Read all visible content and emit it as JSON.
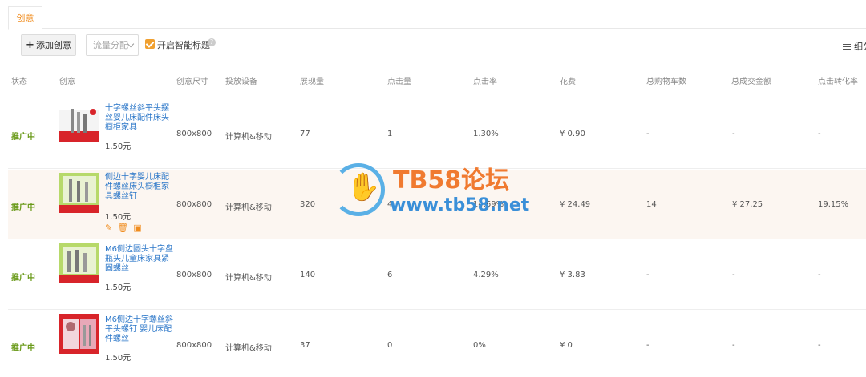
{
  "tabs": {
    "active": "创意"
  },
  "toolbar": {
    "add_label": "添加创意",
    "traffic_select": "流量分配",
    "smart_title_label": "开启智能标题",
    "detail_label": "细分"
  },
  "table": {
    "headers": [
      "状态",
      "创意",
      "创意尺寸",
      "投放设备",
      "展现量",
      "点击量",
      "点击率",
      "花费",
      "总购物车数",
      "总成交金额",
      "点击转化率"
    ],
    "rows": [
      {
        "status": "推广中",
        "name": "十字螺丝斜平头摆丝婴儿床配件床头橱柜家具",
        "price": "1.50元",
        "size": "800x800",
        "device": "计算机&移动",
        "impressions": "77",
        "clicks": "1",
        "ctr": "1.30%",
        "cost": "¥ 0.90",
        "cart": "-",
        "gmv": "-",
        "cvr": "-"
      },
      {
        "status": "推广中",
        "name": "侧边十字婴儿床配件螺丝床头橱柜家具螺丝钉",
        "price": "1.50元",
        "size": "800x800",
        "device": "计算机&移动",
        "impressions": "320",
        "clicks": "4",
        "ctr": "14.69%",
        "cost": "¥ 24.49",
        "cart": "14",
        "gmv": "¥ 27.25",
        "cvr": "19.15%"
      },
      {
        "status": "推广中",
        "name": "M6侧边圆头十字盘瓶头儿童床家具紧固螺丝",
        "price": "1.50元",
        "size": "800x800",
        "device": "计算机&移动",
        "impressions": "140",
        "clicks": "6",
        "ctr": "4.29%",
        "cost": "¥ 3.83",
        "cart": "-",
        "gmv": "-",
        "cvr": "-"
      },
      {
        "status": "推广中",
        "name": "M6侧边十字螺丝斜平头螺钉 婴儿床配件螺丝",
        "price": "1.50元",
        "size": "800x800",
        "device": "计算机&移动",
        "impressions": "37",
        "clicks": "0",
        "ctr": "0%",
        "cost": "¥ 0",
        "cart": "-",
        "gmv": "-",
        "cvr": "-"
      }
    ]
  },
  "watermark": {
    "title": "TB58论坛",
    "url": "www.tb58.net"
  },
  "colors": {
    "accent": "#f08c1e",
    "status": "#6a9a1a",
    "link": "#2a76c8",
    "highlight_row": "#fcf6f1"
  }
}
